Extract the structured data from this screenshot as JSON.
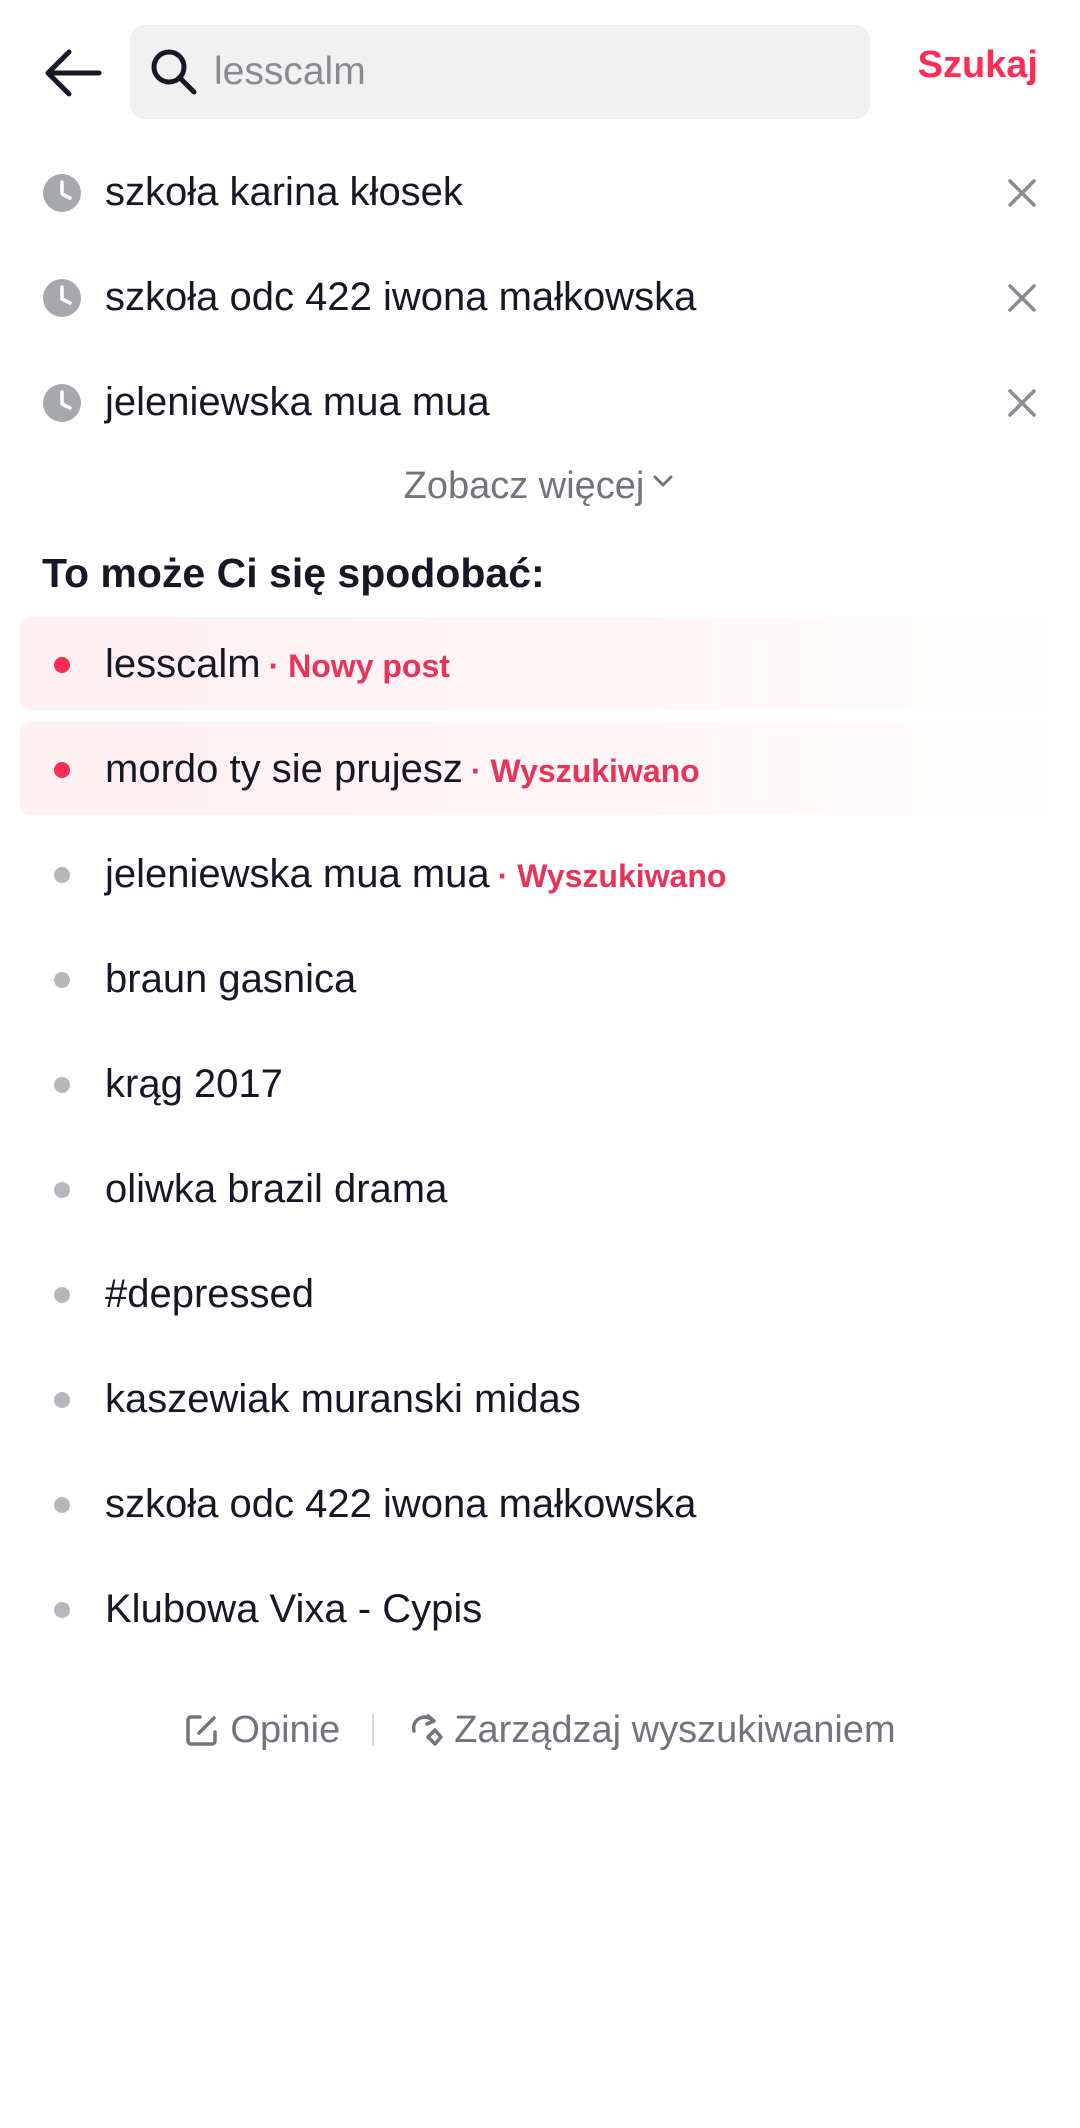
{
  "header": {
    "search_placeholder": "lesscalm",
    "search_value": "",
    "submit_label": "Szukaj"
  },
  "history": [
    {
      "text": "szkoła karina kłosek"
    },
    {
      "text": "szkoła odc 422 iwona małkowska"
    },
    {
      "text": "jeleniewska mua mua"
    }
  ],
  "see_more_label": "Zobacz więcej",
  "suggestions_title": "To może Ci się spodobać:",
  "suggestions": [
    {
      "text": "lesscalm",
      "tag": "· Nowy post",
      "highlighted": true
    },
    {
      "text": "mordo ty sie prujesz",
      "tag": "· Wyszukiwano",
      "highlighted": true
    },
    {
      "text": "jeleniewska mua mua",
      "tag": "· Wyszukiwano",
      "highlighted": false
    },
    {
      "text": "braun gasnica",
      "tag": "",
      "highlighted": false
    },
    {
      "text": "krąg 2017",
      "tag": "",
      "highlighted": false
    },
    {
      "text": "oliwka brazil drama",
      "tag": "",
      "highlighted": false
    },
    {
      "text": "#depressed",
      "tag": "",
      "highlighted": false
    },
    {
      "text": "kaszewiak muranski midas",
      "tag": "",
      "highlighted": false
    },
    {
      "text": "szkoła odc 422 iwona małkowska",
      "tag": "",
      "highlighted": false
    },
    {
      "text": "Klubowa Vixa - Cypis",
      "tag": "",
      "highlighted": false
    }
  ],
  "footer": {
    "feedback_label": "Opinie",
    "manage_label": "Zarządzaj wyszukiwaniem"
  },
  "colors": {
    "accent": "#fe2c55",
    "tag": "#e8335a",
    "text": "#161823",
    "secondary": "#73747b"
  }
}
